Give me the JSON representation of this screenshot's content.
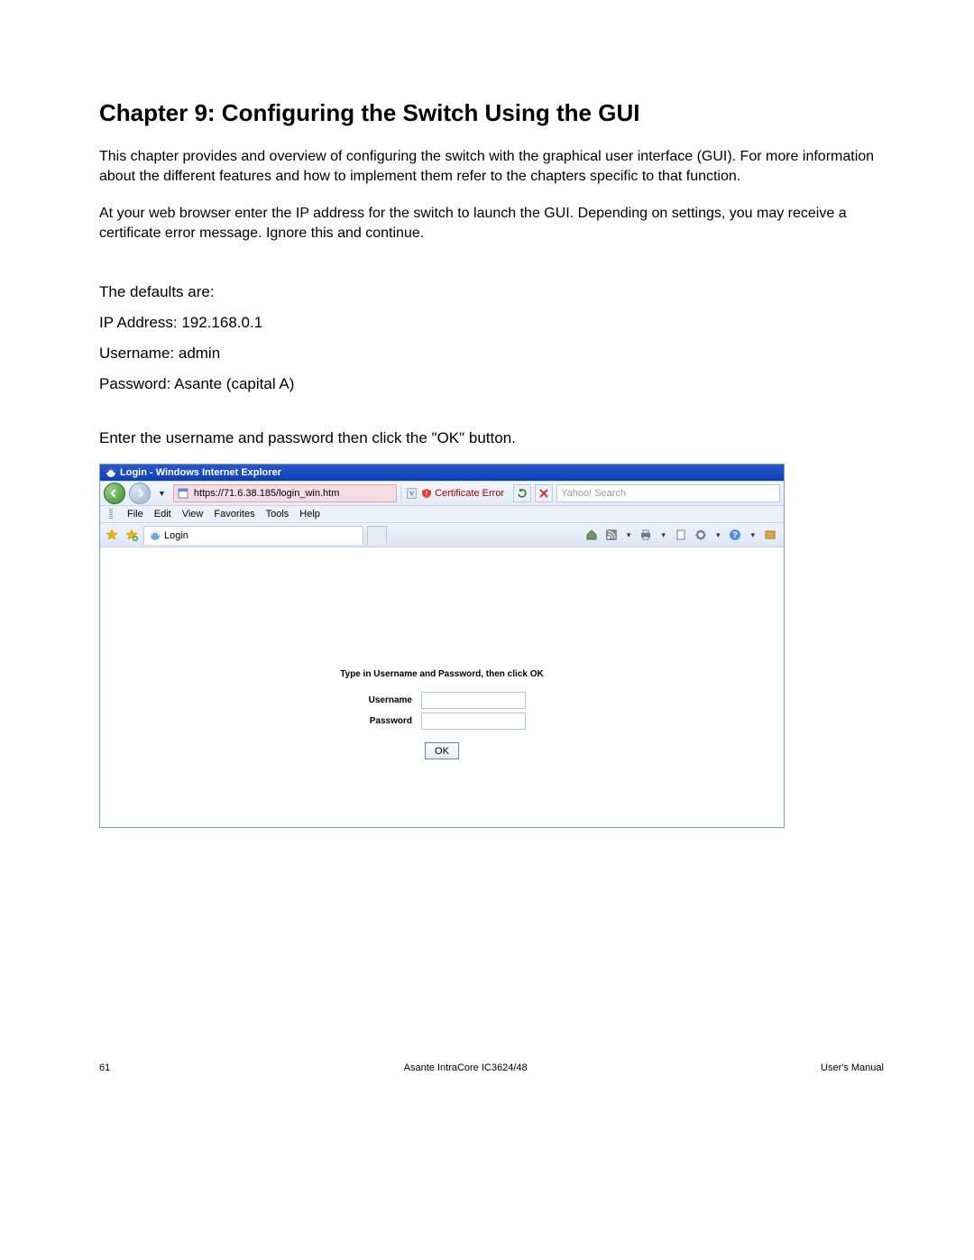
{
  "doc": {
    "chapter_title": "Chapter 9: Configuring the Switch Using the GUI",
    "p1": "This chapter provides and overview of configuring the switch with the graphical user interface (GUI). For more information about the different features and how to implement them refer to the chapters specific to that function.",
    "p2": "At your web browser enter the IP address for the switch to launch the GUI.  Depending on settings, you may receive a certificate error message.  Ignore this and continue.",
    "defaults_heading": "The defaults are:",
    "ip_line": "IP Address:  192.168.0.1",
    "user_line": "Username:   admin",
    "pass_line": "Password:  Asante (capital A)",
    "enter_line": "Enter the username and password then click the \"OK\" button."
  },
  "ie": {
    "window_title": "Login - Windows Internet Explorer",
    "url": "https://71.6.38.185/login_win.htm",
    "cert_error": "Certificate Error",
    "search_placeholder": "Yahoo! Search",
    "menus": [
      "File",
      "Edit",
      "View",
      "Favorites",
      "Tools",
      "Help"
    ],
    "tab_label": "Login",
    "login_prompt": "Type in Username and Password, then click OK",
    "username_label": "Username",
    "password_label": "Password",
    "ok_label": "OK"
  },
  "footer": {
    "page_num": "61",
    "center": "Asante IntraCore IC3624/48",
    "right": "User's Manual"
  }
}
